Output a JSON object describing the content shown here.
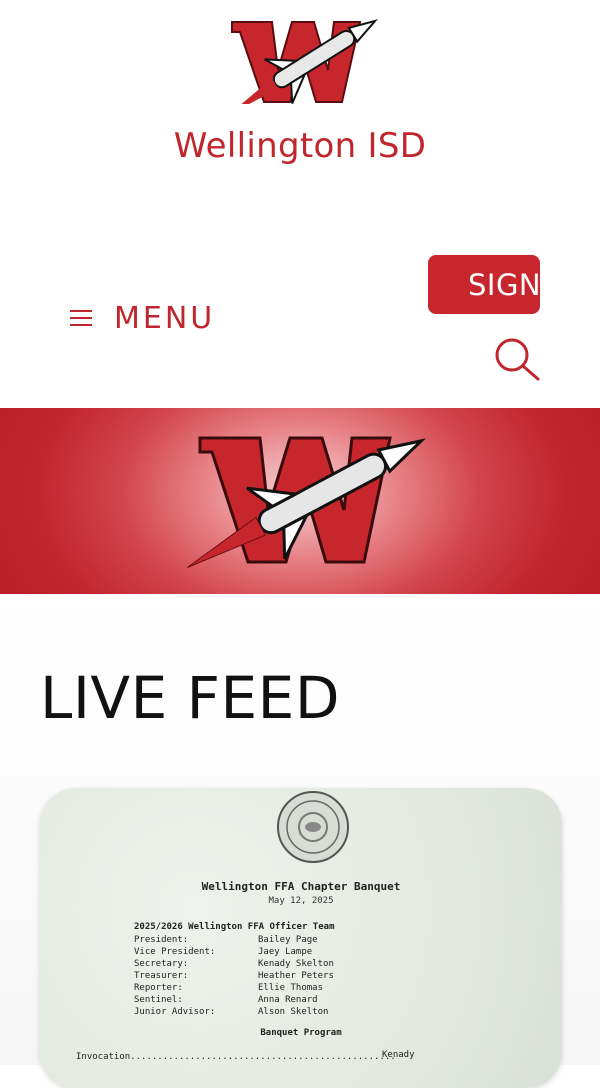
{
  "header": {
    "site_title": "Wellington ISD",
    "sign_button_label": "SIGN",
    "menu_label": "MENU",
    "icons": {
      "menu": "hamburger-icon",
      "search": "search-icon",
      "logo": "wellington-rocket-w-logo"
    }
  },
  "colors": {
    "brand_red": "#c8262d",
    "banner_red": "#c1252d",
    "text_dark": "#111111"
  },
  "main": {
    "section_title": "LIVE FEED",
    "post": {
      "doc_title": "Wellington FFA Chapter Banquet",
      "doc_date": "May 12, 2025",
      "team_heading": "2025/2026 Wellington FFA Officer Team",
      "officers": [
        {
          "role": "President:",
          "name": "Bailey Page"
        },
        {
          "role": "Vice President:",
          "name": "Jaey Lampe"
        },
        {
          "role": "Secretary:",
          "name": "Kenady Skelton"
        },
        {
          "role": "Treasurer:",
          "name": "Heather Peters"
        },
        {
          "role": "Reporter:",
          "name": "Ellie Thomas"
        },
        {
          "role": "Sentinel:",
          "name": "Anna Renard"
        },
        {
          "role": "Junior Advisor:",
          "name": "Alson Skelton"
        }
      ],
      "program_heading": "Banquet Program",
      "invocation_label": "Invocation.................................................",
      "invocation_name": "Kenady"
    }
  }
}
